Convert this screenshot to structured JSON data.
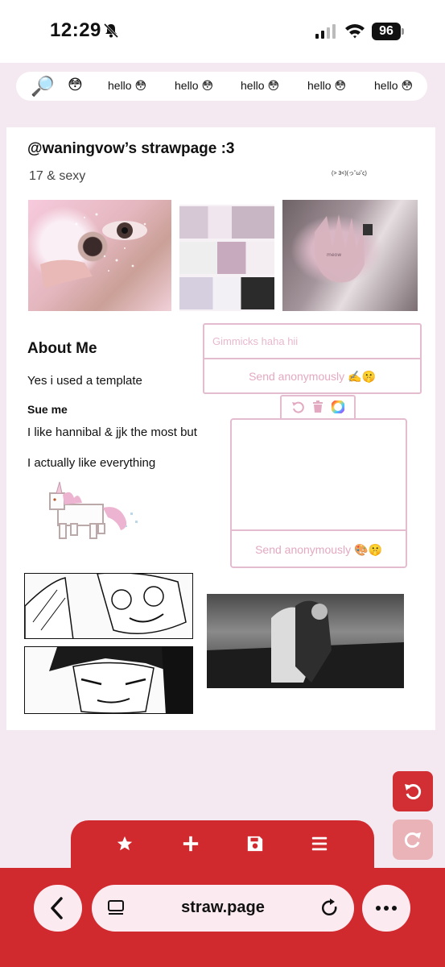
{
  "status_bar": {
    "time": "12:29",
    "battery": "96"
  },
  "marquee": {
    "search_emoji": "🔎",
    "first_emoji": "😳",
    "items": [
      "hello 😳",
      "hello 😳",
      "hello 😳",
      "hello 😳",
      "hello 😳"
    ]
  },
  "profile": {
    "title": "@waningvow’s strawpage :3",
    "subtitle": "17 & sexy",
    "tiny_note": "(> 3<)(っ˘ω˘ς)"
  },
  "message_form": {
    "placeholder": "Gimmicks haha hii",
    "send_label": "Send anonymously ✍️🤫"
  },
  "about": {
    "title": "About Me",
    "line1": "Yes i used a template",
    "bold_line": "Sue me",
    "line2": "I like hannibal & jjk the most but",
    "line3": "I actually like everything"
  },
  "drawing_widget": {
    "send_label": "Send anonymously 🎨🤫"
  },
  "browser": {
    "url": "straw.page"
  },
  "colors": {
    "accent_red": "#d0292e",
    "pink_border": "#e3bcd0",
    "pink_text": "#e3a9c1",
    "background": "#f5e9f1"
  }
}
